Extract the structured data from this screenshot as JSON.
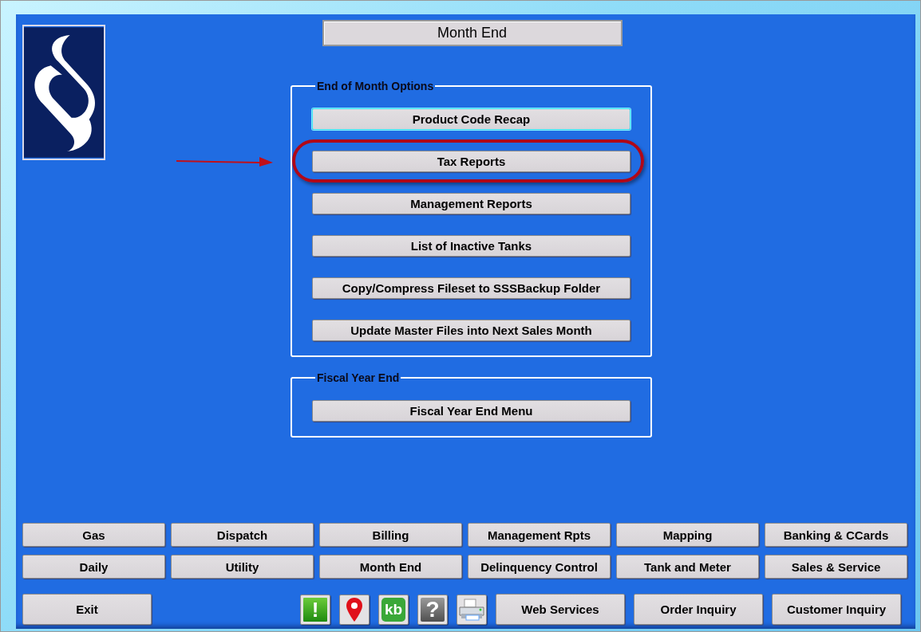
{
  "title": "Month End",
  "groups": [
    {
      "legend": "End of Month Options",
      "buttons": [
        {
          "label": "Product Code Recap",
          "focused": true,
          "highlighted": false
        },
        {
          "label": "Tax Reports",
          "focused": false,
          "highlighted": true
        },
        {
          "label": "Management Reports",
          "focused": false,
          "highlighted": false
        },
        {
          "label": "List of Inactive Tanks",
          "focused": false,
          "highlighted": false
        },
        {
          "label": "Copy/Compress Fileset to SSSBackup Folder",
          "focused": false,
          "highlighted": false
        },
        {
          "label": "Update Master Files into Next Sales Month",
          "focused": false,
          "highlighted": false
        }
      ]
    },
    {
      "legend": "Fiscal Year End",
      "buttons": [
        {
          "label": "Fiscal Year End Menu",
          "focused": false,
          "highlighted": false
        }
      ]
    }
  ],
  "nav_buttons": [
    "Gas",
    "Dispatch",
    "Billing",
    "Management Rpts",
    "Mapping",
    "Banking & CCards",
    "Daily",
    "Utility",
    "Month End",
    "Delinquency Control",
    "Tank and Meter",
    "Sales & Service"
  ],
  "exit_button": "Exit",
  "tool_icons": [
    {
      "kind": "alert",
      "glyph": "!"
    },
    {
      "kind": "pin"
    },
    {
      "kind": "kb",
      "glyph": "kb"
    },
    {
      "kind": "help",
      "glyph": "?"
    },
    {
      "kind": "printer"
    }
  ],
  "bottom_buttons": [
    "Web Services",
    "Order Inquiry",
    "Customer Inquiry"
  ]
}
